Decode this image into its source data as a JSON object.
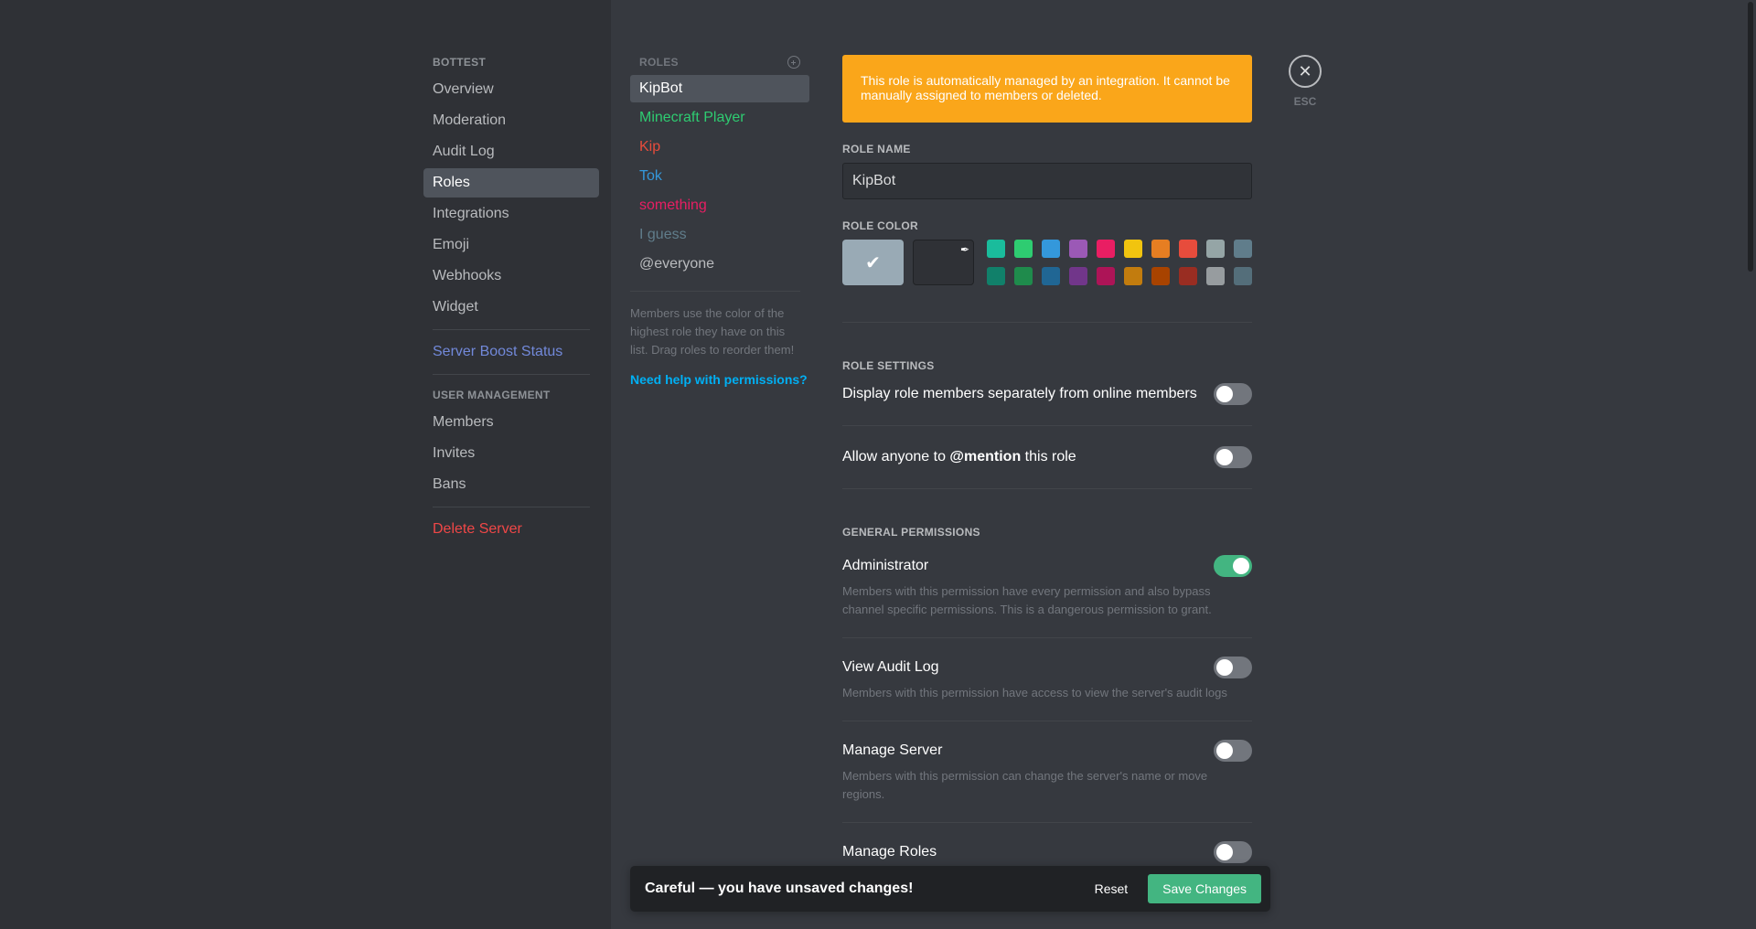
{
  "sidebar": {
    "server_header": "BOTTEST",
    "items": [
      "Overview",
      "Moderation",
      "Audit Log",
      "Roles",
      "Integrations",
      "Emoji",
      "Webhooks",
      "Widget"
    ],
    "boost": "Server Boost Status",
    "user_mgmt_header": "USER MANAGEMENT",
    "user_items": [
      "Members",
      "Invites",
      "Bans"
    ],
    "delete": "Delete Server"
  },
  "roles": {
    "header": "ROLES",
    "items": [
      {
        "name": "KipBot",
        "color": "#ffffff"
      },
      {
        "name": "Minecraft Player",
        "color": "#2ecc71"
      },
      {
        "name": "Kip",
        "color": "#e74c3c"
      },
      {
        "name": "Tok",
        "color": "#3498db"
      },
      {
        "name": "something",
        "color": "#e91e63"
      },
      {
        "name": "I guess",
        "color": "#607d8b"
      },
      {
        "name": "@everyone",
        "color": "#b9bbbe"
      }
    ],
    "note": "Members use the color of the highest role they have on this list. Drag roles to reorder them!",
    "help": "Need help with permissions?"
  },
  "close": {
    "label": "ESC"
  },
  "main": {
    "notice": "This role is automatically managed by an integration. It cannot be manually assigned to members or deleted.",
    "role_name_title": "ROLE NAME",
    "role_name_value": "KipBot",
    "role_color_title": "ROLE COLOR",
    "colors_row1": [
      "#1abc9c",
      "#2ecc71",
      "#3498db",
      "#9b59b6",
      "#e91e63",
      "#f1c40f",
      "#e67e22",
      "#e74c3c",
      "#95a5a6",
      "#607d8b"
    ],
    "colors_row2": [
      "#11806a",
      "#1f8b4c",
      "#206694",
      "#71368a",
      "#ad1457",
      "#c27c0e",
      "#a84300",
      "#992d22",
      "#979c9f",
      "#546e7a"
    ],
    "role_settings_title": "ROLE SETTINGS",
    "setting1": "Display role members separately from online members",
    "setting2_pre": "Allow anyone to ",
    "setting2_bold": "@mention",
    "setting2_post": " this role",
    "general_title": "GENERAL PERMISSIONS",
    "perms": [
      {
        "name": "Administrator",
        "desc": "Members with this permission have every permission and also bypass channel specific permissions. This is a dangerous permission to grant.",
        "on": true
      },
      {
        "name": "View Audit Log",
        "desc": "Members with this permission have access to view the server's audit logs",
        "on": false
      },
      {
        "name": "Manage Server",
        "desc": "Members with this permission can change the server's name or move regions.",
        "on": false
      },
      {
        "name": "Manage Roles",
        "desc": "",
        "on": false
      }
    ]
  },
  "unsaved": {
    "message": "Careful — you have unsaved changes!",
    "reset": "Reset",
    "save": "Save Changes"
  }
}
